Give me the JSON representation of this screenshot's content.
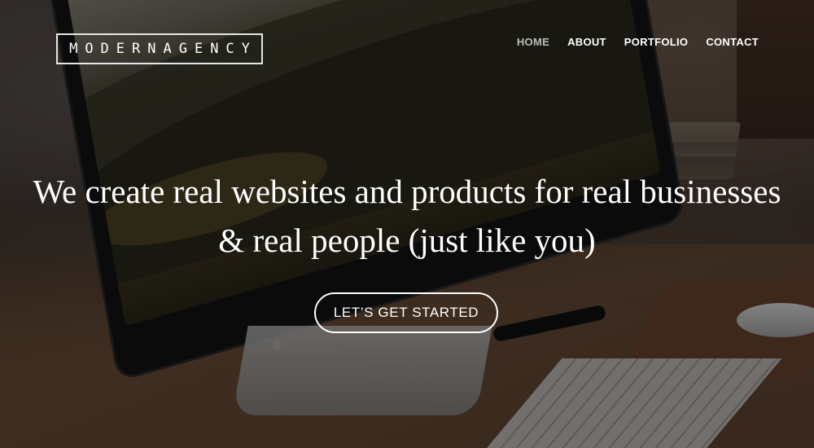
{
  "brand": {
    "logo_text": "MODERNAGENCY"
  },
  "nav": {
    "items": [
      {
        "label": "HOME",
        "active": true
      },
      {
        "label": "ABOUT",
        "active": false
      },
      {
        "label": "PORTFOLIO",
        "active": false
      },
      {
        "label": "CONTACT",
        "active": false
      }
    ]
  },
  "hero": {
    "headline_line1": "We create real websites and products for real businesses",
    "headline_line2": "& real people (just like you)",
    "cta_label": "LET’S GET STARTED"
  },
  "colors": {
    "text": "#ffffff",
    "nav_active": "#bdbdbd"
  }
}
